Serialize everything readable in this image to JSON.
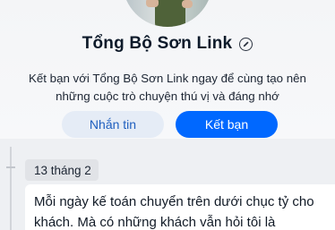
{
  "profile": {
    "name": "Tổng Bộ Sơn Link",
    "invite_text": "Kết bạn với Tổng Bộ Sơn Link ngay để cùng tạo nên những cuộc trò chuyện thú vị và đáng nhớ",
    "message_button": "Nhắn tin",
    "add_friend_button": "Kết bạn"
  },
  "timeline": {
    "date": "13 tháng 2",
    "post_text": "Mỗi ngày kế toán chuyển trên dưới chục tỷ cho khách. Mà có những khách vẫn hỏi tôi là"
  },
  "colors": {
    "accent": "#0068ff",
    "secondary_button_bg": "#e5ecf6"
  },
  "icons": [
    "avatar",
    "edit-icon"
  ]
}
